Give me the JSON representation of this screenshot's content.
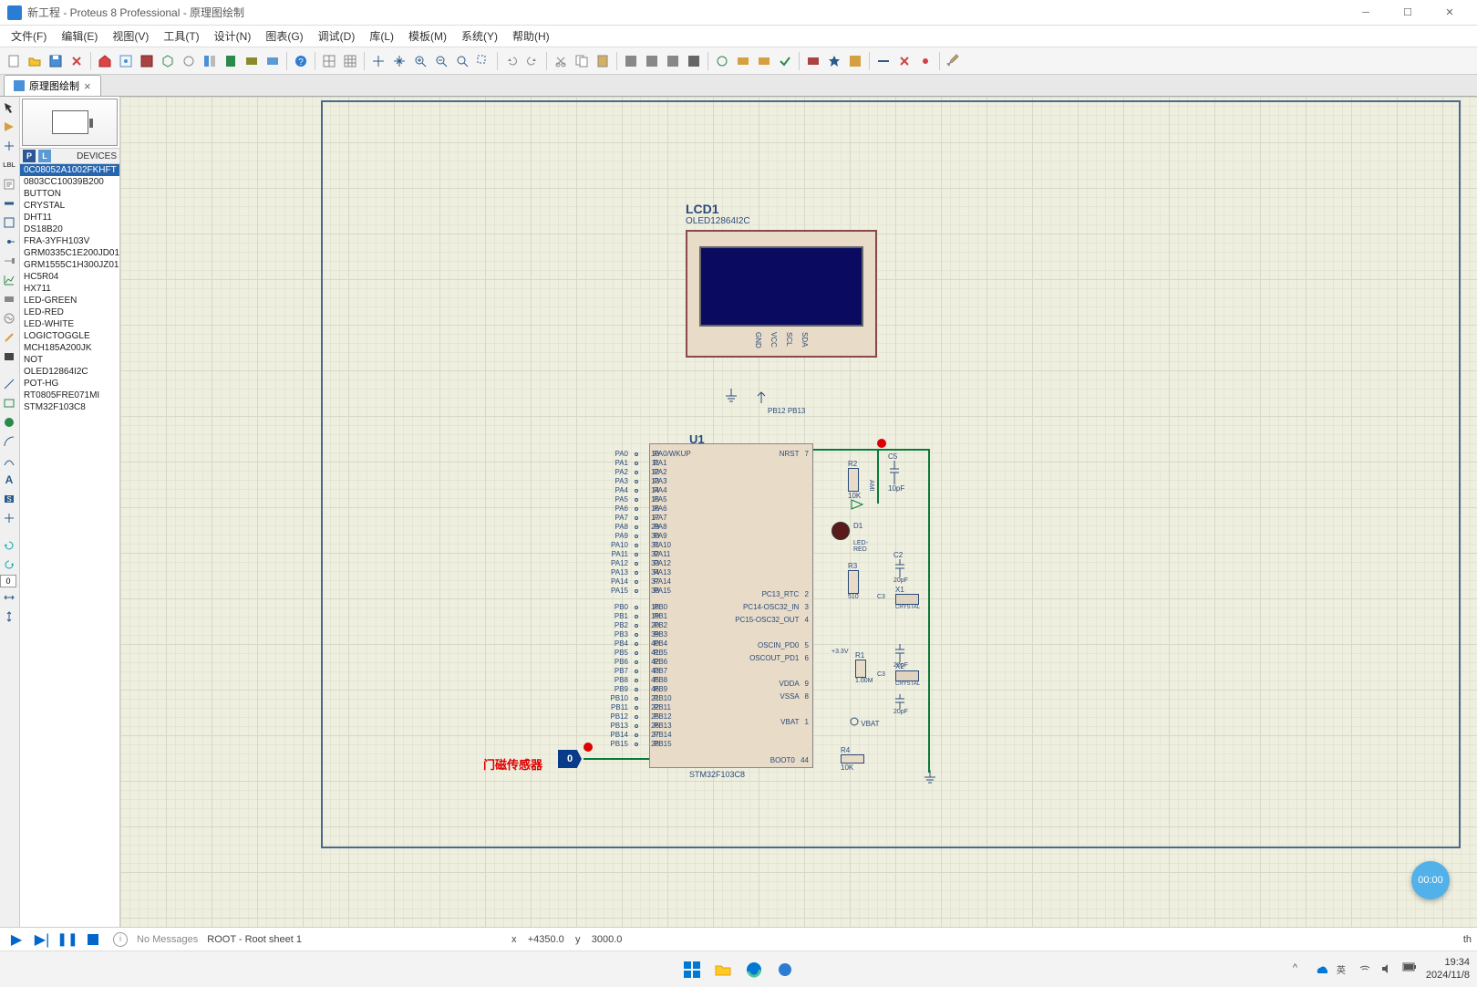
{
  "title": "新工程 - Proteus 8 Professional - 原理图绘制",
  "menu": [
    "文件(F)",
    "编辑(E)",
    "视图(V)",
    "工具(T)",
    "设计(N)",
    "图表(G)",
    "调试(D)",
    "库(L)",
    "模板(M)",
    "系统(Y)",
    "帮助(H)"
  ],
  "tab": {
    "label": "原理图绘制",
    "close": "×"
  },
  "devices": {
    "header_p": "P",
    "header_l": "L",
    "header_label": "DEVICES",
    "items": [
      "0C08052A1002FKHFT",
      "0803CC10039B200",
      "BUTTON",
      "CRYSTAL",
      "DHT11",
      "DS18B20",
      "FRA-3YFH103V",
      "GRM0335C1E200JD01D",
      "GRM1555C1H300JZ01D",
      "HC5R04",
      "HX711",
      "LED-GREEN",
      "LED-RED",
      "LED-WHITE",
      "LOGICTOGGLE",
      "MCH185A200JK",
      "NOT",
      "OLED12864I2C",
      "POT-HG",
      "RT0805FRE071MI",
      "STM32F103C8"
    ],
    "selected_index": 0
  },
  "lcd": {
    "ref": "LCD1",
    "part": "OLED12864I2C",
    "pins": [
      "GND",
      "VCC",
      "SCL",
      "SDA"
    ],
    "below_pins": [
      "PB12",
      "PB13"
    ]
  },
  "mcu": {
    "ref": "U1",
    "part": "STM32F103C8",
    "left_outer": [
      {
        "n": "10",
        "l": "PA0"
      },
      {
        "n": "11",
        "l": "PA1"
      },
      {
        "n": "12",
        "l": "PA2"
      },
      {
        "n": "13",
        "l": "PA3"
      },
      {
        "n": "14",
        "l": "PA4"
      },
      {
        "n": "15",
        "l": "PA5"
      },
      {
        "n": "16",
        "l": "PA6"
      },
      {
        "n": "17",
        "l": "PA7"
      },
      {
        "n": "29",
        "l": "PA8"
      },
      {
        "n": "30",
        "l": "PA9"
      },
      {
        "n": "31",
        "l": "PA10"
      },
      {
        "n": "32",
        "l": "PA11"
      },
      {
        "n": "33",
        "l": "PA12"
      },
      {
        "n": "34",
        "l": "PA13"
      },
      {
        "n": "37",
        "l": "PA14"
      },
      {
        "n": "38",
        "l": "PA15"
      },
      {
        "n": "18",
        "l": "PB0"
      },
      {
        "n": "19",
        "l": "PB1"
      },
      {
        "n": "20",
        "l": "PB2"
      },
      {
        "n": "39",
        "l": "PB3"
      },
      {
        "n": "40",
        "l": "PB4"
      },
      {
        "n": "41",
        "l": "PB5"
      },
      {
        "n": "42",
        "l": "PB6"
      },
      {
        "n": "43",
        "l": "PB7"
      },
      {
        "n": "45",
        "l": "PB8"
      },
      {
        "n": "46",
        "l": "PB9"
      },
      {
        "n": "21",
        "l": "PB10"
      },
      {
        "n": "22",
        "l": "PB11"
      },
      {
        "n": "25",
        "l": "PB12"
      },
      {
        "n": "26",
        "l": "PB13"
      },
      {
        "n": "27",
        "l": "PB14"
      },
      {
        "n": "28",
        "l": "PB15"
      }
    ],
    "left_inner": [
      "PA0/WKUP",
      "PA1",
      "PA2",
      "PA3",
      "PA4",
      "PA5",
      "PA6",
      "PA7",
      "PA8",
      "PA9",
      "PA10",
      "PA11",
      "PA12",
      "PA13",
      "PA14",
      "PA15",
      "PB0",
      "PB1",
      "PB2",
      "PB3",
      "PB4",
      "PB5",
      "PB6",
      "PB7",
      "PB8",
      "PB9",
      "PB10",
      "PB11",
      "PB12",
      "PB13",
      "PB14",
      "PB15"
    ],
    "right_inner": [
      "NRST",
      "",
      "",
      "",
      "",
      "",
      "",
      "",
      "",
      "",
      "",
      "PC13_RTC",
      "PC14-OSC32_IN",
      "PC15-OSC32_OUT",
      "",
      "OSCIN_PD0",
      "OSCOUT_PD1",
      "",
      "VDDA",
      "VSSA",
      "",
      "VBAT",
      "",
      "",
      "BOOT0"
    ],
    "right_nums": [
      "7",
      "",
      "",
      "",
      "",
      "",
      "",
      "",
      "",
      "",
      "",
      "2",
      "3",
      "4",
      "",
      "5",
      "6",
      "",
      "9",
      "8",
      "",
      "1",
      "",
      "",
      "44"
    ]
  },
  "periph": {
    "r2": {
      "ref": "R2",
      "val": "10K"
    },
    "r3": {
      "ref": "R3",
      "val": "510"
    },
    "r1": {
      "ref": "R1",
      "val": "1.00M"
    },
    "r4": {
      "ref": "R4",
      "val": "10K"
    },
    "c5": {
      "ref": "C5",
      "val": "10pF"
    },
    "c2": {
      "ref": "C2",
      "val": "20pF"
    },
    "c3": {
      "ref": "C3",
      "val": "20pF"
    },
    "c4": {
      "val": "20pF"
    },
    "d1": {
      "ref": "D1",
      "val": "LED-RED"
    },
    "x1": {
      "ref": "X1",
      "val": "CRYSTAL"
    },
    "x2": {
      "ref": "X2",
      "val": "CRYSTAL"
    },
    "v33": "+3.3V",
    "vbat": "VBAT",
    "ami": "AMI"
  },
  "sensor_label": "门磁传感器",
  "logic_val": "0",
  "sim_timer": "00:00",
  "status": {
    "no_messages": "No Messages",
    "sheet": "ROOT - Root sheet 1",
    "coord_x_label": "x",
    "coord_x": "+4350.0",
    "coord_y_label": "y",
    "coord_y": "3000.0",
    "th": "th"
  },
  "tray": {
    "time": "19:34",
    "date": "2024/11/8"
  }
}
